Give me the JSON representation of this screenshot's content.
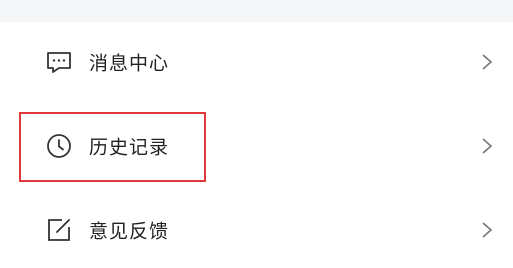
{
  "menu": {
    "items": [
      {
        "label": "消息中心",
        "icon": "message-icon"
      },
      {
        "label": "历史记录",
        "icon": "clock-icon"
      },
      {
        "label": "意见反馈",
        "icon": "feedback-edit-icon"
      }
    ]
  },
  "colors": {
    "highlight": "#e0393b",
    "icon": "#333333",
    "text": "#222222",
    "chevron": "#777777"
  }
}
